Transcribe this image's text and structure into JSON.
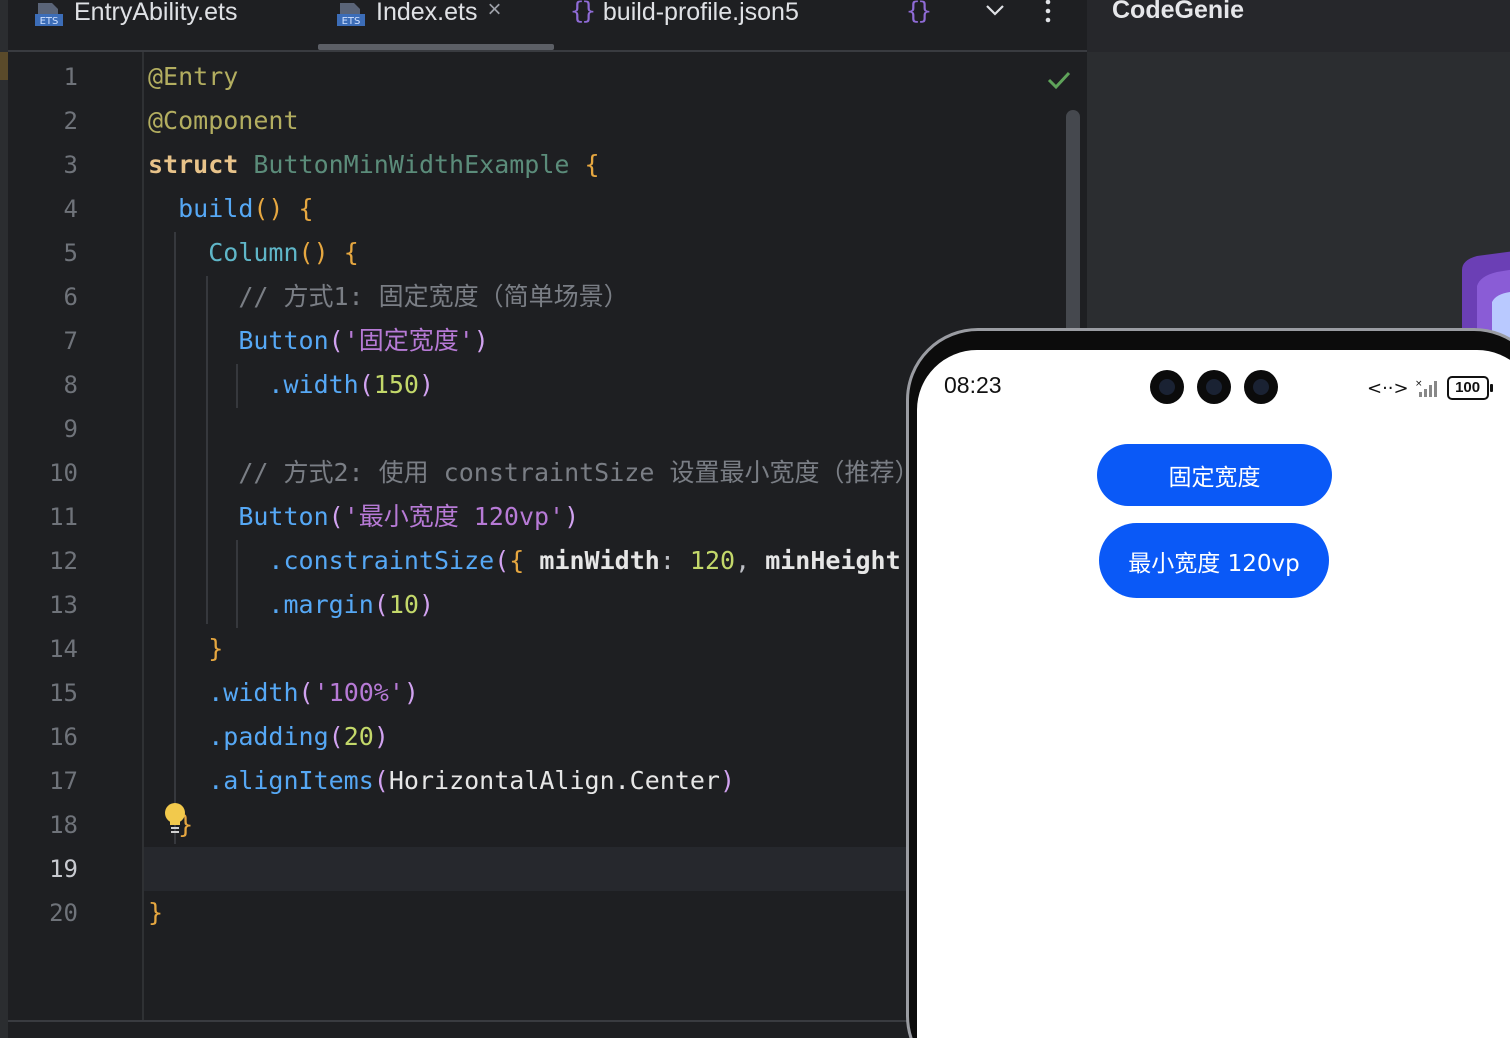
{
  "tabs": [
    {
      "label": "EntryAbility.ets",
      "icon": "ets-file-icon",
      "active": false
    },
    {
      "label": "Index.ets",
      "icon": "ets-file-icon",
      "active": true
    },
    {
      "label": "build-profile.json5",
      "icon": "json-braces-icon",
      "active": false
    }
  ],
  "right_panel": {
    "title": "CodeGenie"
  },
  "line_numbers": [
    "1",
    "2",
    "3",
    "4",
    "5",
    "6",
    "7",
    "8",
    "9",
    "10",
    "11",
    "12",
    "13",
    "14",
    "15",
    "16",
    "17",
    "18",
    "19",
    "20"
  ],
  "current_line": "19",
  "code": {
    "l1": "@Entry",
    "l2": "@Component",
    "l3_kw": "struct",
    "l3_name": "ButtonMinWidthExample",
    "l4_fn": "build",
    "l5_fn": "Column",
    "l6_comment": "// 方式1: 固定宽度（简单场景）",
    "l7_fn": "Button",
    "l7_str": "'固定宽度'",
    "l8_method": ".width",
    "l8_num": "150",
    "l10_comment": "// 方式2: 使用 constraintSize 设置最小宽度（推荐）",
    "l11_fn": "Button",
    "l11_str": "'最小宽度 120vp'",
    "l12_method": ".constraintSize",
    "l12_key1": "minWidth",
    "l12_num1": "120",
    "l12_key2": "minHeight",
    "l13_method": ".margin",
    "l13_num": "10",
    "l15_method": ".width",
    "l15_str": "'100%'",
    "l16_method": ".padding",
    "l16_num": "20",
    "l17_method": ".alignItems",
    "l17_arg": "HorizontalAlign.Center"
  },
  "preview": {
    "time": "08:23",
    "battery": "100",
    "button1": "固定宽度",
    "button2": "最小宽度 120vp",
    "accent": "#0a59f7"
  },
  "colors": {
    "editor_bg": "#1e1f22",
    "panel_bg": "#2b2d30"
  }
}
